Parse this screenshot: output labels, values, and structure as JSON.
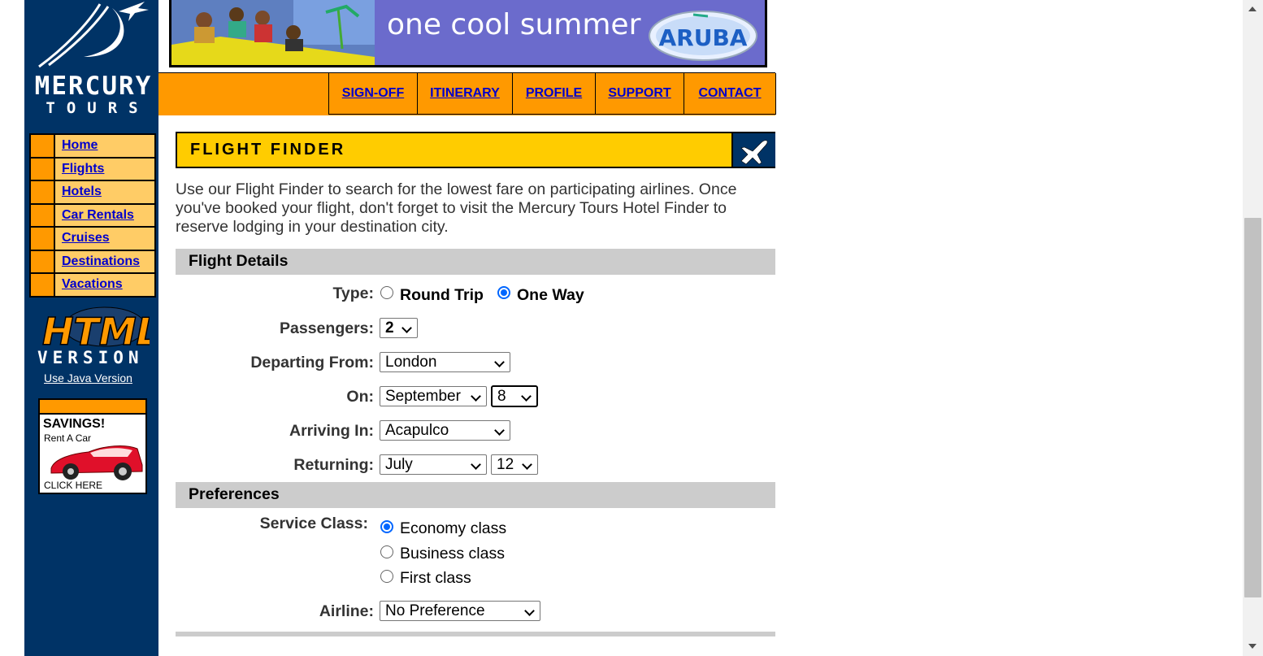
{
  "brand": {
    "line1": "MERCURY",
    "line2": "TOURS"
  },
  "banner": {
    "text": "one cool summer",
    "badge": "ARUBA"
  },
  "top_menu": [
    {
      "label": "SIGN-OFF"
    },
    {
      "label": "ITINERARY"
    },
    {
      "label": "PROFILE"
    },
    {
      "label": "SUPPORT"
    },
    {
      "label": "CONTACT"
    }
  ],
  "left_nav": [
    {
      "label": "Home"
    },
    {
      "label": "Flights"
    },
    {
      "label": "Hotels"
    },
    {
      "label": "Car Rentals"
    },
    {
      "label": "Cruises"
    },
    {
      "label": "Destinations"
    },
    {
      "label": "Vacations"
    }
  ],
  "html_version": {
    "line1": "HTML",
    "line2": "VERSION"
  },
  "java_link": "Use Java Version",
  "savings_ad": {
    "title": "SAVINGS!",
    "subtitle": "Rent A Car",
    "cta": "CLICK HERE"
  },
  "flight_finder": {
    "title": "FLIGHT FINDER",
    "intro": "Use our Flight Finder to search for the lowest fare on participating airlines. Once you've booked your flight, don't forget to visit the Mercury Tours Hotel Finder to reserve lodging in your destination city."
  },
  "flight_details": {
    "heading": "Flight Details",
    "type_label": "Type:",
    "type_options": [
      "Round Trip",
      "One Way"
    ],
    "type_selected": "One Way",
    "passengers_label": "Passengers:",
    "passengers_value": "2",
    "departing_label": "Departing From:",
    "departing_value": "London",
    "on_label": "On:",
    "on_month": "September",
    "on_day": "8",
    "arriving_label": "Arriving In:",
    "arriving_value": "Acapulco",
    "returning_label": "Returning:",
    "returning_month": "July",
    "returning_day": "12"
  },
  "preferences": {
    "heading": "Preferences",
    "service_label": "Service Class:",
    "service_options": [
      "Economy class",
      "Business class",
      "First class"
    ],
    "service_selected": "Economy class",
    "airline_label": "Airline:",
    "airline_value": "No Preference"
  },
  "colors": {
    "nav_blue": "#003366",
    "accent_orange": "#ff9900",
    "header_yellow": "#ffcc00",
    "link_blue": "#0000cc",
    "radio_blue": "#0066ff"
  }
}
